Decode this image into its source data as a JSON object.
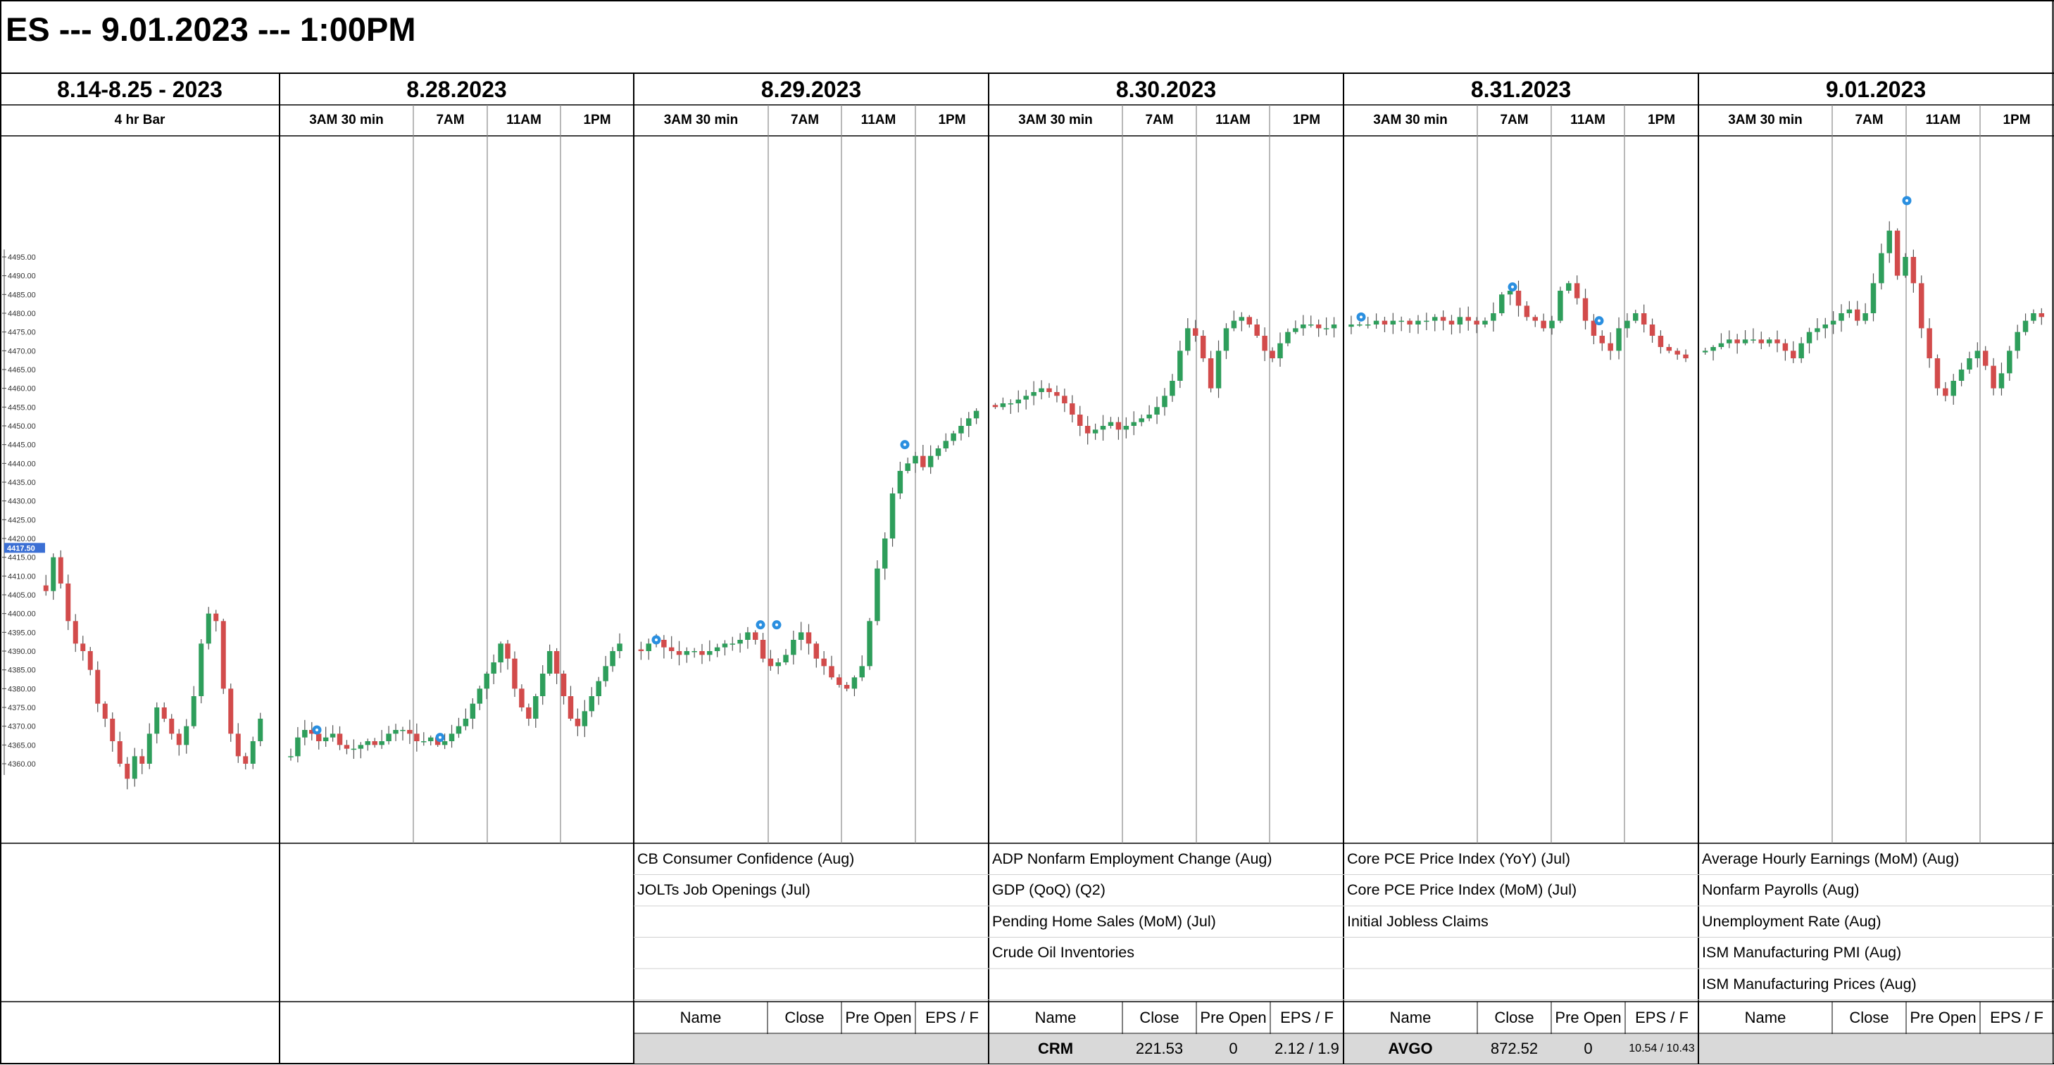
{
  "title": "ES --- 9.01.2023 --- 1:00PM",
  "days": [
    {
      "label": "8.14-8.25 - 2023",
      "subs": [
        "4 hr Bar"
      ]
    },
    {
      "label": "8.28.2023",
      "subs": [
        "3AM 30 min",
        "7AM",
        "11AM",
        "1PM"
      ]
    },
    {
      "label": "8.29.2023",
      "subs": [
        "3AM 30 min",
        "7AM",
        "11AM",
        "1PM"
      ]
    },
    {
      "label": "8.30.2023",
      "subs": [
        "3AM 30 min",
        "7AM",
        "11AM",
        "1PM"
      ]
    },
    {
      "label": "8.31.2023",
      "subs": [
        "3AM 30 min",
        "7AM",
        "11AM",
        "1PM"
      ]
    },
    {
      "label": "9.01.2023",
      "subs": [
        "3AM 30 min",
        "7AM",
        "11AM",
        "1PM"
      ]
    }
  ],
  "events": [
    [],
    [],
    [
      "CB Consumer Confidence (Aug)",
      "JOLTs Job Openings (Jul)"
    ],
    [
      "ADP Nonfarm Employment Change (Aug)",
      "GDP (QoQ) (Q2)",
      "Pending Home Sales (MoM) (Jul)",
      "Crude Oil Inventories"
    ],
    [
      "Core PCE Price Index (YoY) (Jul)",
      "Core PCE Price Index (MoM) (Jul)",
      "Initial Jobless Claims"
    ],
    [
      "Average Hourly Earnings (MoM) (Aug)",
      "Nonfarm Payrolls (Aug)",
      "Unemployment Rate (Aug)",
      "ISM Manufacturing PMI (Aug)",
      "ISM Manufacturing Prices (Aug)"
    ]
  ],
  "earnings": {
    "headers": [
      "Name",
      "Close",
      "Pre Open",
      "EPS / F"
    ],
    "rows": [
      null,
      null,
      null,
      {
        "name": "CRM",
        "close": "221.53",
        "pre_open": "0",
        "eps": "2.12 / 1.9"
      },
      {
        "name": "AVGO",
        "close": "872.52",
        "pre_open": "0",
        "eps": "10.54 / 10.43"
      },
      null
    ]
  },
  "colors": {
    "up": "#2e9e5b",
    "down": "#d24b4b",
    "grid": "#000000",
    "gray": "#d9d9d9",
    "marker": "#2a8fe0",
    "price_label": "#3b6fd4"
  },
  "chart_data": {
    "type": "candlestick",
    "symbol": "ES",
    "y_axis_ticks": [
      4360,
      4365,
      4370,
      4375,
      4380,
      4385,
      4390,
      4395,
      4400,
      4405,
      4410,
      4415,
      4420,
      4425,
      4430,
      4435,
      4440,
      4445,
      4450,
      4455,
      4460,
      4465,
      4470,
      4475,
      4480,
      4485,
      4490,
      4495
    ],
    "y_tick_labels": [
      "4360.00",
      "4365.00",
      "4370.00",
      "4375.00",
      "4380.00",
      "4385.00",
      "4390.00",
      "4395.00",
      "4400.00",
      "4405.00",
      "4410.00",
      "4415.00",
      "4420.00",
      "4425.00",
      "4430.00",
      "4435.00",
      "4440.00",
      "4445.00",
      "4450.00",
      "4455.00",
      "4460.00",
      "4465.00",
      "4470.00",
      "4475.00",
      "4480.00",
      "4485.00",
      "4490.00",
      "4495.00"
    ],
    "current_price": "4417.50",
    "ylim": [
      4345,
      4510
    ],
    "panels": [
      {
        "day": "8.14-8.25 - 2023",
        "path": [
          4406,
          4415,
          4408,
          4398,
          4392,
          4390,
          4385,
          4376,
          4372,
          4366,
          4360,
          4356,
          4362,
          4360,
          4368,
          4375,
          4372,
          4368,
          4365,
          4370,
          4378,
          4392,
          4400,
          4398,
          4380,
          4368,
          4362,
          4360,
          4366,
          4372
        ]
      },
      {
        "day": "8.28.2023",
        "path": [
          4362,
          4367,
          4369,
          4368,
          4366,
          4367,
          4368,
          4365,
          4364,
          4364,
          4365,
          4366,
          4365,
          4366,
          4368,
          4369,
          4369,
          4368,
          4366,
          4366,
          4367,
          4365,
          4366,
          4368,
          4370,
          4372,
          4376,
          4380,
          4384,
          4387,
          4392,
          4388,
          4380,
          4375,
          4372,
          4378,
          4384,
          4390,
          4384,
          4378,
          4372,
          4370,
          4374,
          4378,
          4382,
          4386,
          4390,
          4392
        ]
      },
      {
        "day": "8.29.2023",
        "path": [
          4390,
          4392,
          4393,
          4391,
          4390,
          4389,
          4390,
          4390,
          4389,
          4390,
          4391,
          4392,
          4392,
          4393,
          4395,
          4393,
          4388,
          4386,
          4387,
          4389,
          4393,
          4395,
          4392,
          4388,
          4386,
          4383,
          4381,
          4380,
          4383,
          4386,
          4398,
          4412,
          4420,
          4432,
          4438,
          4440,
          4442,
          4439,
          4442,
          4444,
          4446,
          4448,
          4450,
          4452,
          4454
        ]
      },
      {
        "day": "8.30.2023",
        "path": [
          4455,
          4456,
          4456,
          4457,
          4458,
          4459,
          4460,
          4459,
          4458,
          4456,
          4453,
          4450,
          4448,
          4449,
          4450,
          4451,
          4449,
          4450,
          4451,
          4452,
          4453,
          4455,
          4458,
          4462,
          4470,
          4476,
          4474,
          4468,
          4460,
          4470,
          4476,
          4478,
          4479,
          4477,
          4474,
          4470,
          4468,
          4472,
          4475,
          4476,
          4477,
          4477,
          4476,
          4476,
          4477
        ]
      },
      {
        "day": "8.31.2023",
        "path": [
          4477,
          4477,
          4477,
          4478,
          4477,
          4478,
          4478,
          4477,
          4478,
          4478,
          4479,
          4478,
          4477,
          4479,
          4478,
          4477,
          4478,
          4480,
          4485,
          4486,
          4482,
          4479,
          4478,
          4476,
          4478,
          4486,
          4488,
          4484,
          4478,
          4474,
          4472,
          4470,
          4476,
          4478,
          4480,
          4477,
          4474,
          4471,
          4470,
          4469,
          4468
        ]
      },
      {
        "day": "9.01.2023",
        "path": [
          4470,
          4471,
          4472,
          4473,
          4472,
          4473,
          4473,
          4472,
          4473,
          4472,
          4470,
          4468,
          4472,
          4475,
          4476,
          4477,
          4478,
          4480,
          4481,
          4478,
          4480,
          4488,
          4496,
          4502,
          4490,
          4495,
          4488,
          4476,
          4468,
          4460,
          4458,
          4462,
          4465,
          4468,
          4470,
          4466,
          4460,
          4464,
          4470,
          4475,
          4478,
          4480,
          4479
        ]
      }
    ]
  }
}
